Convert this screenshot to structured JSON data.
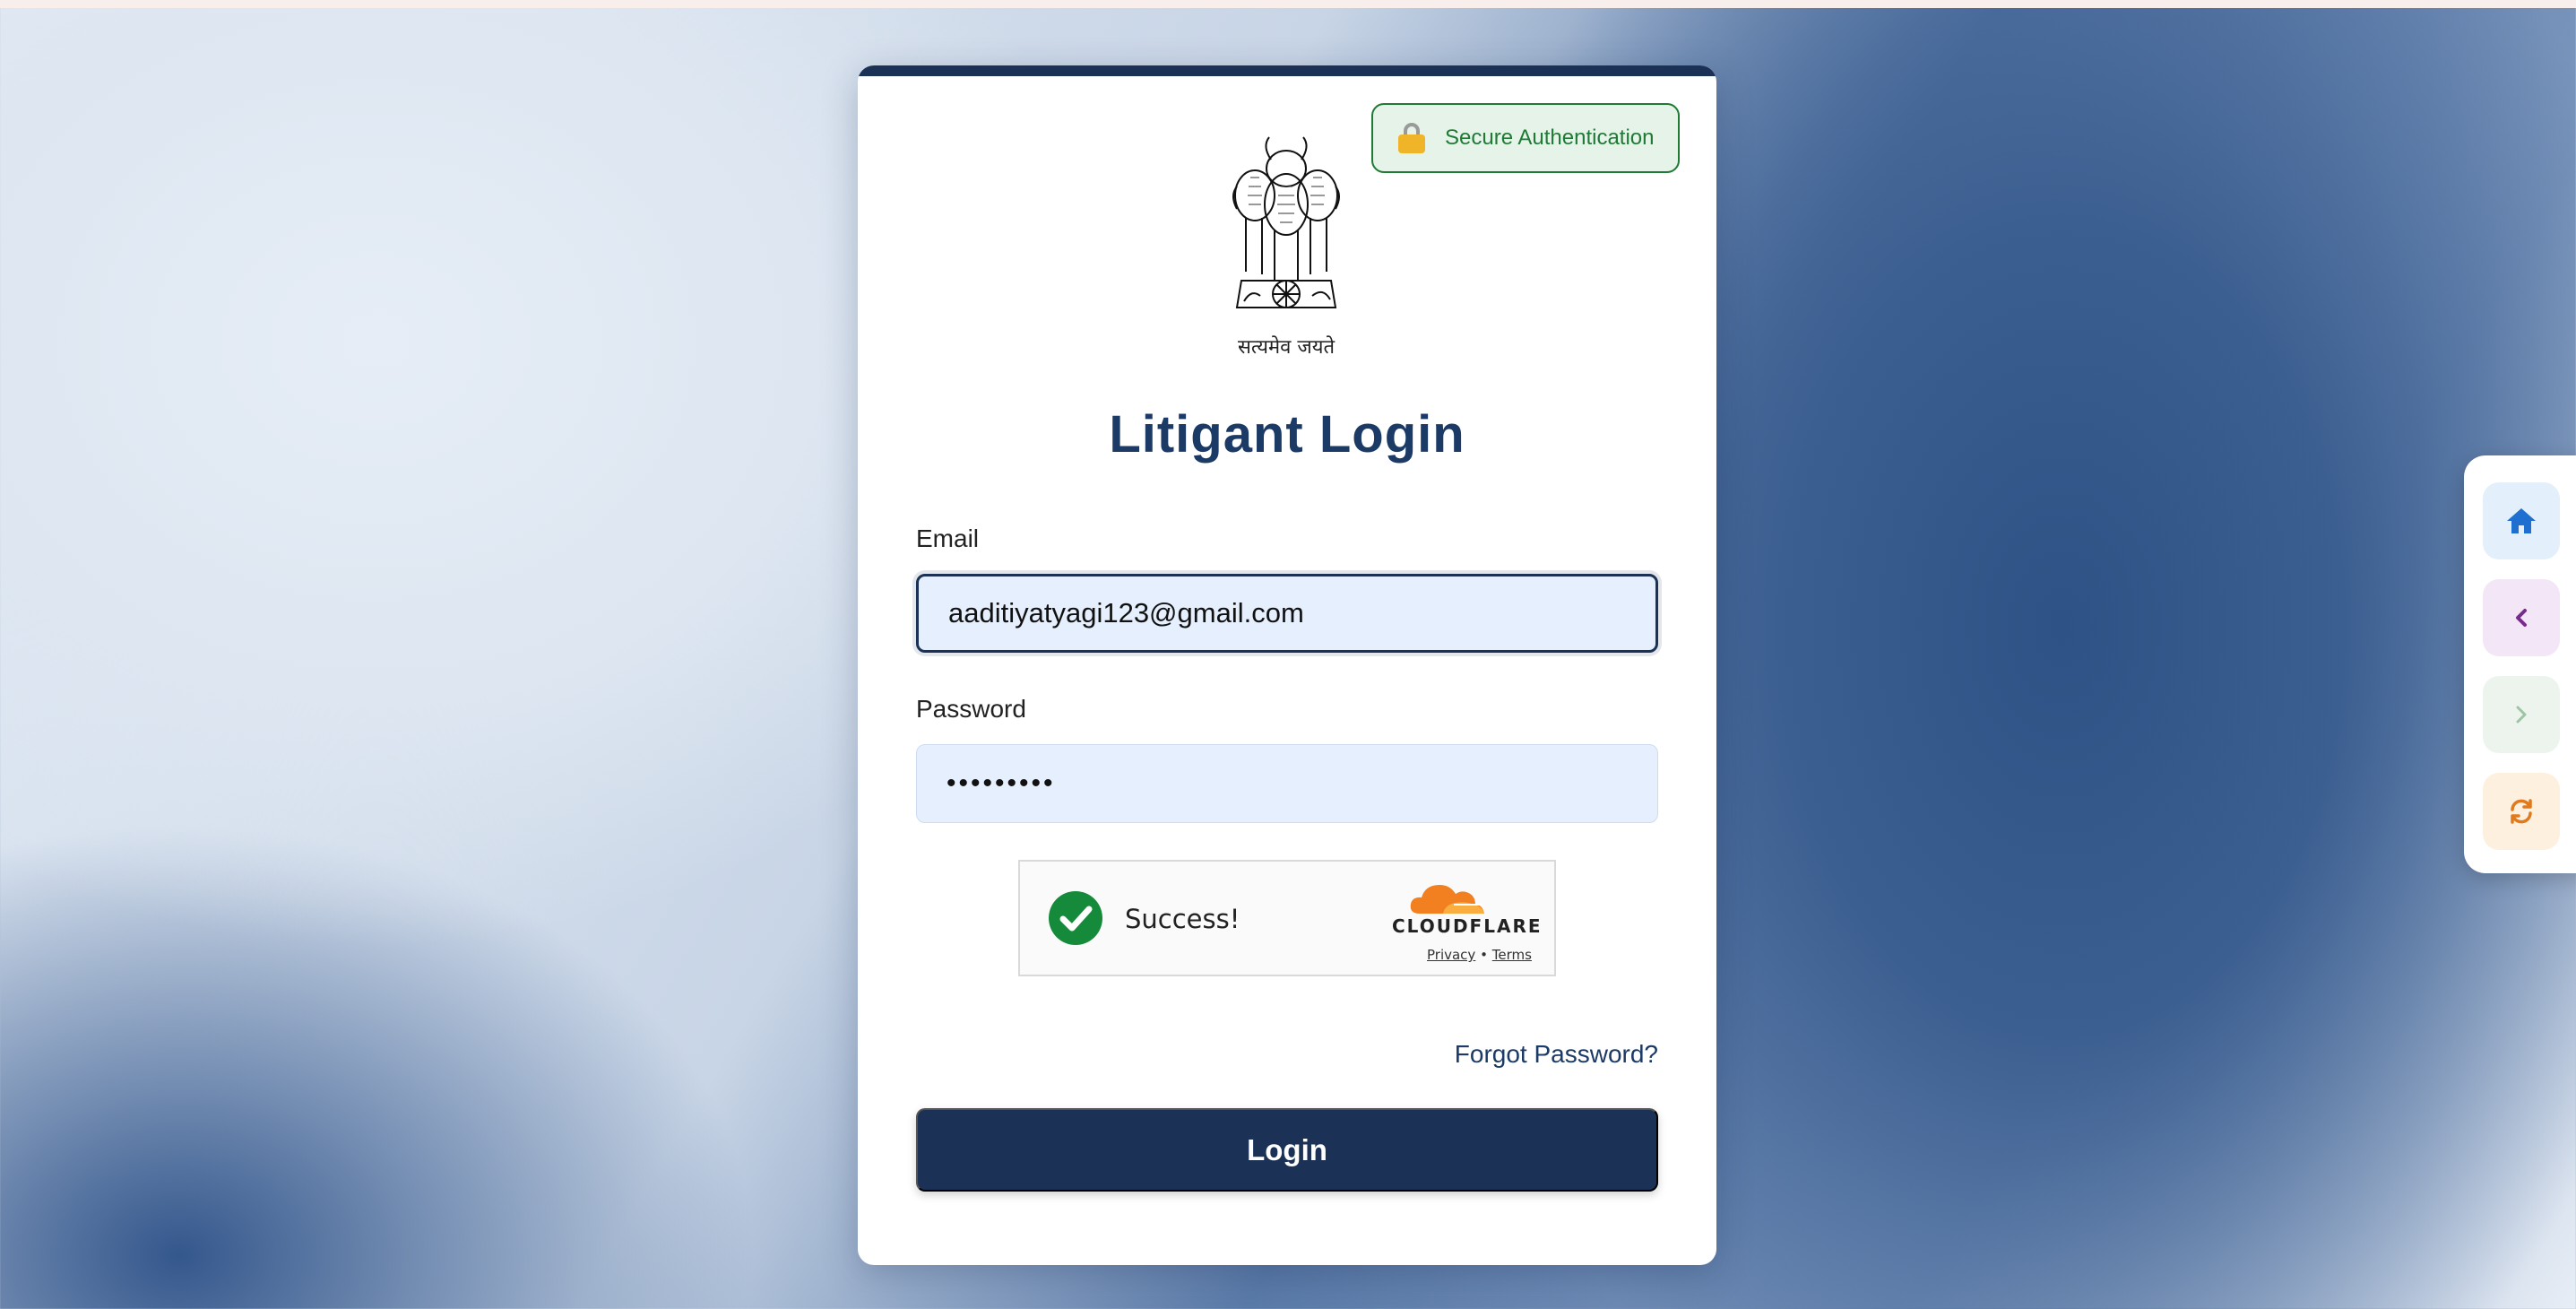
{
  "badge": {
    "text": "Secure Authentication",
    "icon": "lock-icon"
  },
  "emblem": {
    "motto": "सत्यमेव जयते"
  },
  "title": "Litigant Login",
  "form": {
    "email_label": "Email",
    "email_value": "aaditiyatyagi123@gmail.com",
    "password_label": "Password",
    "password_value": "•••••••••",
    "forgot_label": "Forgot Password?",
    "login_label": "Login"
  },
  "captcha": {
    "status": "Success!",
    "brand": "CLOUDFLARE",
    "privacy": "Privacy",
    "separator": "•",
    "terms": "Terms"
  },
  "side_nav": {
    "buttons": [
      "home-icon",
      "chevron-left-icon",
      "chevron-right-icon",
      "refresh-icon"
    ]
  },
  "colors": {
    "primary": "#1b3256",
    "success": "#1f7a35",
    "field_bg": "#e6effd"
  }
}
